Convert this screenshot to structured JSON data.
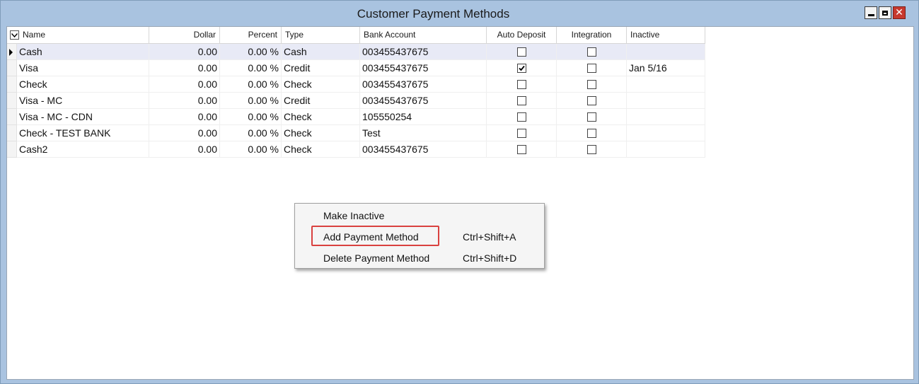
{
  "window": {
    "title": "Customer Payment Methods"
  },
  "grid": {
    "columns": [
      "Name",
      "Dollar",
      "Percent",
      "Type",
      "Bank Account",
      "Auto Deposit",
      "Integration",
      "Inactive"
    ],
    "rows": [
      {
        "name": "Cash",
        "dollar": "0.00",
        "percent": "0.00 %",
        "type": "Cash",
        "bank": "003455437675",
        "auto_deposit": false,
        "integration": false,
        "inactive": ""
      },
      {
        "name": "Visa",
        "dollar": "0.00",
        "percent": "0.00 %",
        "type": "Credit",
        "bank": "003455437675",
        "auto_deposit": true,
        "integration": false,
        "inactive": "Jan 5/16"
      },
      {
        "name": "Check",
        "dollar": "0.00",
        "percent": "0.00 %",
        "type": "Check",
        "bank": "003455437675",
        "auto_deposit": false,
        "integration": false,
        "inactive": ""
      },
      {
        "name": "Visa - MC",
        "dollar": "0.00",
        "percent": "0.00 %",
        "type": "Credit",
        "bank": "003455437675",
        "auto_deposit": false,
        "integration": false,
        "inactive": ""
      },
      {
        "name": "Visa - MC - CDN",
        "dollar": "0.00",
        "percent": "0.00 %",
        "type": "Check",
        "bank": "105550254",
        "auto_deposit": false,
        "integration": false,
        "inactive": ""
      },
      {
        "name": "Check - TEST BANK",
        "dollar": "0.00",
        "percent": "0.00 %",
        "type": "Check",
        "bank": "Test",
        "auto_deposit": false,
        "integration": false,
        "inactive": ""
      },
      {
        "name": "Cash2",
        "dollar": "0.00",
        "percent": "0.00 %",
        "type": "Check",
        "bank": "003455437675",
        "auto_deposit": false,
        "integration": false,
        "inactive": ""
      }
    ]
  },
  "context_menu": {
    "items": [
      {
        "label": "Make Inactive",
        "shortcut": ""
      },
      {
        "label": "Add Payment Method",
        "shortcut": "Ctrl+Shift+A"
      },
      {
        "label": "Delete Payment Method",
        "shortcut": "Ctrl+Shift+D"
      }
    ]
  },
  "colors": {
    "titlebar": "#a9c3e0",
    "close_button": "#c7392e",
    "highlight_box": "#d9413f",
    "selected_row": "#e8eaf6"
  },
  "icons": [
    "minimize-icon",
    "maximize-icon",
    "close-icon",
    "column-chooser-icon",
    "row-pointer-icon",
    "checkmark-icon"
  ]
}
